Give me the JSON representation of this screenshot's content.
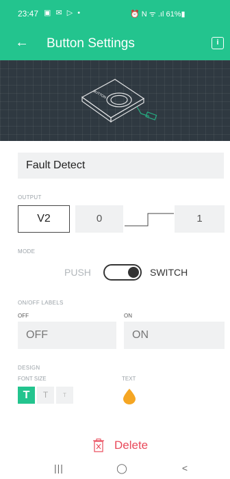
{
  "status_bar": {
    "time": "23:47",
    "icons_left": "▣ ✉ ▷ •",
    "icons_right": "⏰ N ᯤ .ıl 61%▮"
  },
  "app_bar": {
    "title": "Button Settings",
    "back_icon": "arrow-left",
    "info_icon": "info"
  },
  "preview": {
    "device_label": "BUTTON",
    "tag_label": "PIN"
  },
  "widget": {
    "name": "Fault Detect"
  },
  "output": {
    "section_label": "OUTPUT",
    "pin": "V2",
    "min": "0",
    "max": "1"
  },
  "mode": {
    "section_label": "MODE",
    "push_label": "PUSH",
    "switch_label": "SWITCH",
    "selected": "SWITCH"
  },
  "labels": {
    "section_label": "ON/OFF LABELS",
    "off_caption": "OFF",
    "on_caption": "ON",
    "off_value": "OFF",
    "on_value": "ON"
  },
  "design": {
    "section_label": "DESIGN",
    "font_size_label": "FONT SIZE",
    "text_label": "TEXT",
    "font_size_glyph": "T",
    "selected_font_size": "large",
    "text_color": "#f5a623"
  },
  "actions": {
    "delete_label": "Delete"
  },
  "nav_bar": {
    "recents": "|||",
    "home": "◯",
    "back": "<"
  },
  "colors": {
    "accent": "#23c48e",
    "danger": "#e9495a",
    "preview_bg": "#2f3941"
  }
}
